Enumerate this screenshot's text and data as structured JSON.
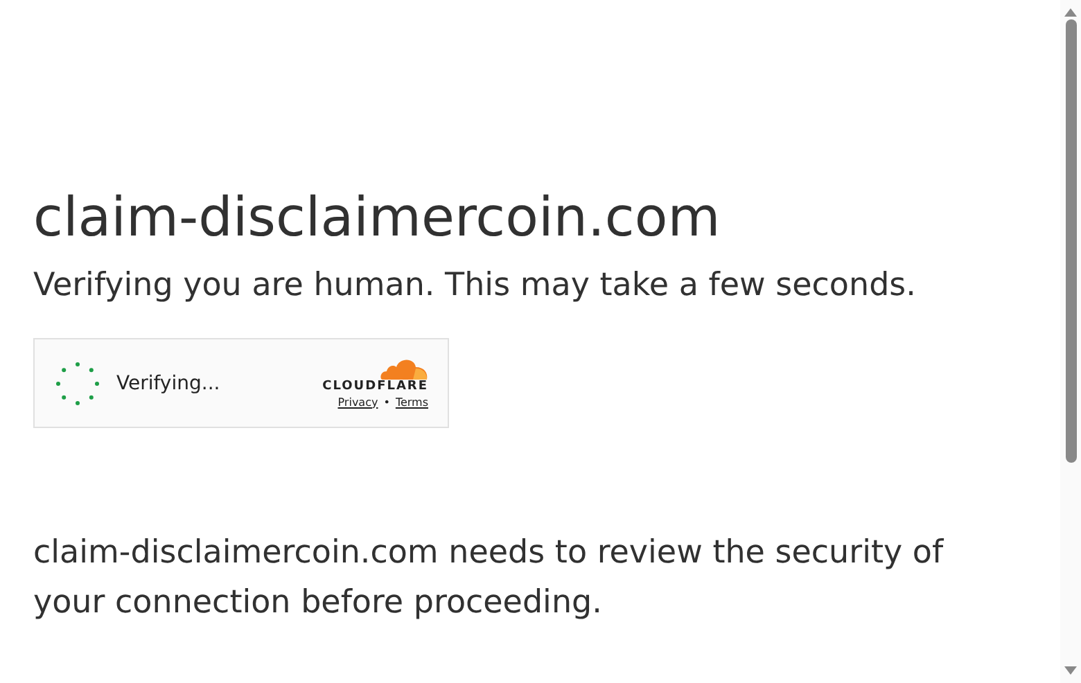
{
  "heading": "claim-disclaimercoin.com",
  "subtitle": "Verifying you are human. This may take a few seconds.",
  "widget": {
    "status": "Verifying...",
    "brand": "CLOUDFLARE",
    "links": [
      {
        "label": "Privacy"
      },
      {
        "label": "Terms"
      }
    ],
    "separator": "•"
  },
  "message": "claim-disclaimercoin.com needs to review the security of your connection before proceeding."
}
